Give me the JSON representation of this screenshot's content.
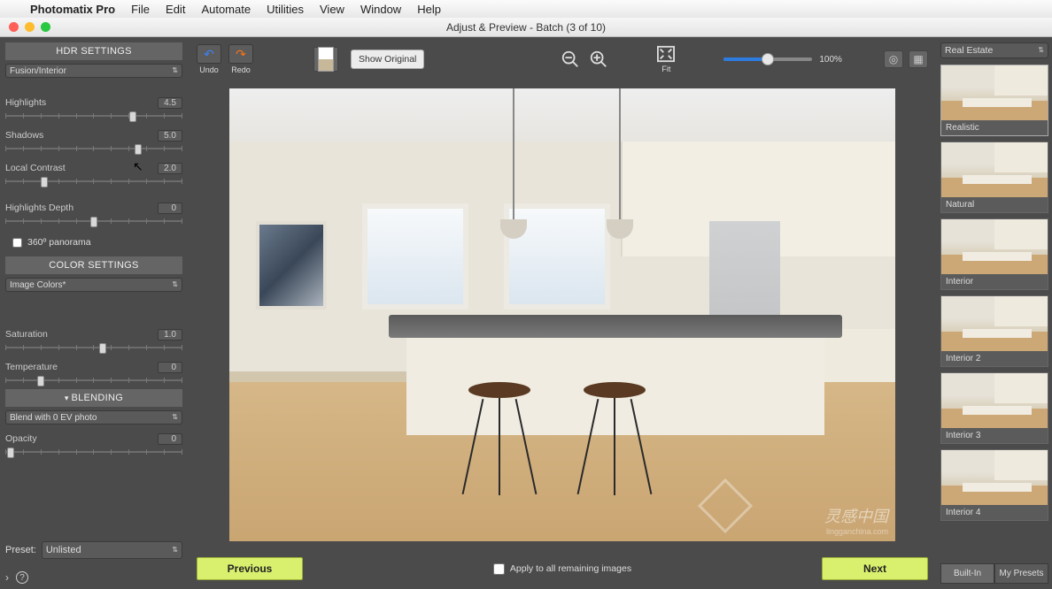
{
  "menubar": {
    "appname": "Photomatix Pro",
    "items": [
      "File",
      "Edit",
      "Automate",
      "Utilities",
      "View",
      "Window",
      "Help"
    ]
  },
  "window_title": "Adjust & Preview - Batch (3 of 10)",
  "left": {
    "hdr_title": "HDR SETTINGS",
    "method_dropdown": "Fusion/Interior",
    "sliders": {
      "highlights": {
        "label": "Highlights",
        "value": "4.5",
        "pos": 72
      },
      "shadows": {
        "label": "Shadows",
        "value": "5.0",
        "pos": 75
      },
      "local": {
        "label": "Local Contrast",
        "value": "2.0",
        "pos": 22
      },
      "hdepth": {
        "label": "Highlights Depth",
        "value": "0",
        "pos": 50
      }
    },
    "panorama": "360º panorama",
    "color_title": "COLOR SETTINGS",
    "color_dropdown": "Image Colors*",
    "color_sliders": {
      "sat": {
        "label": "Saturation",
        "value": "1.0",
        "pos": 55
      },
      "temp": {
        "label": "Temperature",
        "value": "0",
        "pos": 20
      }
    },
    "blend_title": "BLENDING",
    "blend_dropdown": "Blend with  0 EV photo",
    "blend_slider": {
      "label": "Opacity",
      "value": "0",
      "pos": 3
    },
    "preset_label": "Preset:",
    "preset_value": "Unlisted"
  },
  "toolbar": {
    "undo": "Undo",
    "redo": "Redo",
    "show_original": "Show Original",
    "fit": "Fit",
    "zoom_pct": "100%"
  },
  "apply_all": "Apply to all remaining images",
  "prev_btn": "Previous",
  "next_btn": "Next",
  "right": {
    "category": "Real Estate",
    "presets": [
      {
        "label": "Realistic",
        "selected": true
      },
      {
        "label": "Natural",
        "selected": false
      },
      {
        "label": "Interior",
        "selected": false
      },
      {
        "label": "Interior 2",
        "selected": false
      },
      {
        "label": "Interior 3",
        "selected": false
      },
      {
        "label": "Interior 4",
        "selected": false
      }
    ],
    "tab_builtin": "Built-In",
    "tab_my": "My Presets"
  },
  "watermark": {
    "text": "灵感中国",
    "url": "lingganchina.com"
  }
}
